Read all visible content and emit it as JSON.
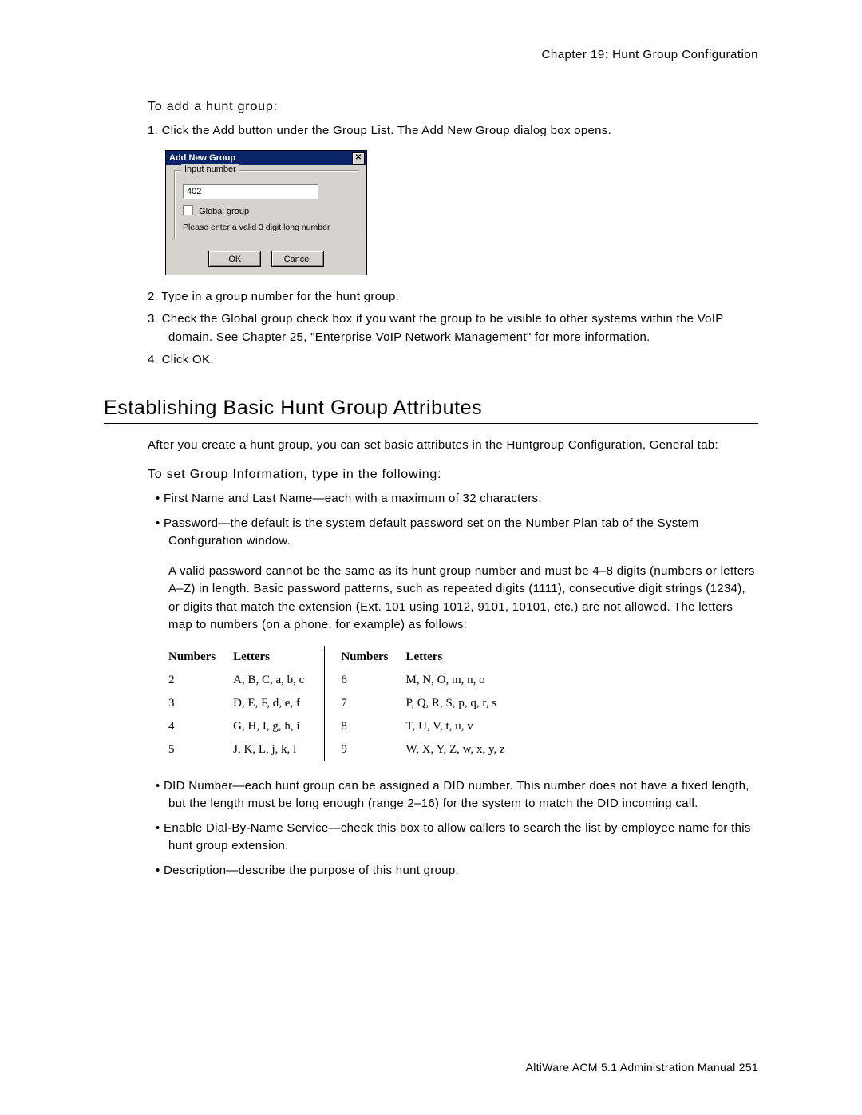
{
  "header": {
    "chapter": "Chapter 19:  Hunt Group Configuration"
  },
  "section1": {
    "title": "To add a hunt group:",
    "step1": "1.  Click the Add button under the Group List. The Add New Group dialog box opens.",
    "step2": "2.  Type in a group number for the hunt group.",
    "step3": "3.  Check the Global group check box if you want the group to be visible to other systems within the VoIP domain. See Chapter 25, \"Enterprise VoIP Network Management\" for more information.",
    "step4": "4.  Click OK."
  },
  "dialog": {
    "title": "Add New Group",
    "legend": "Input number",
    "value": "402",
    "global_label": "Global group",
    "hint": "Please enter a valid 3 digit long number",
    "ok": "OK",
    "cancel": "Cancel"
  },
  "section2": {
    "heading": "Establishing Basic Hunt Group Attributes",
    "intro": "After you create a hunt group, you can set basic attributes in the Huntgroup Configuration, General tab:",
    "subhead": "To set Group Information, type in the following:",
    "b1": "First Name and Last Name—each with a maximum of 32 characters.",
    "b2": "Password—the default is the system default password set on the Number Plan tab of the System Configuration window.",
    "note": "A valid password cannot be the same as its hunt group number and must be 4–8 digits (numbers or letters A–Z) in length. Basic password patterns, such as repeated digits (1111), consecutive digit strings (1234), or digits that match the extension (Ext. 101 using 1012, 9101, 10101, etc.) are not allowed. The letters map to numbers (on a phone, for example) as follows:",
    "b3": "DID Number—each hunt group can be assigned a DID number. This number does not have a fixed length, but the length must be long enough (range 2–16) for the system to match the DID incoming call.",
    "b4": "Enable Dial-By-Name Service—check this box to allow callers to search the list by employee name for this hunt group extension.",
    "b5": "Description—describe the purpose of this hunt group."
  },
  "table": {
    "h_numbers": "Numbers",
    "h_letters": "Letters",
    "left": [
      {
        "n": "2",
        "l": "A, B, C, a, b, c"
      },
      {
        "n": "3",
        "l": "D, E, F, d, e, f"
      },
      {
        "n": "4",
        "l": "G, H, I, g, h, i"
      },
      {
        "n": "5",
        "l": "J, K, L, j, k, l"
      }
    ],
    "right": [
      {
        "n": "6",
        "l": "M, N, O, m, n, o"
      },
      {
        "n": "7",
        "l": "P, Q, R, S, p, q, r, s"
      },
      {
        "n": "8",
        "l": "T, U, V, t, u, v"
      },
      {
        "n": "9",
        "l": "W, X, Y, Z, w, x, y, z"
      }
    ]
  },
  "footer": {
    "text": "AltiWare ACM 5.1 Administration Manual   251"
  }
}
